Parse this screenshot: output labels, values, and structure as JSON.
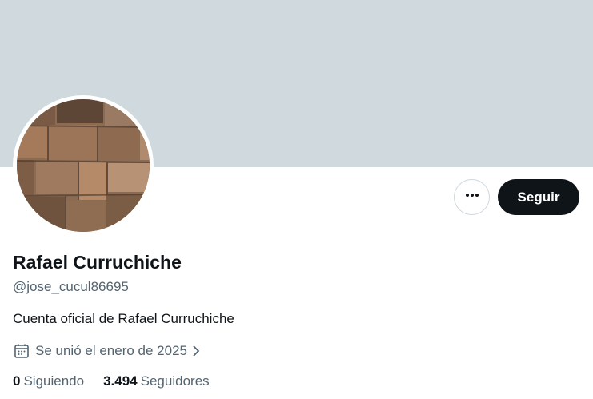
{
  "profile": {
    "name": "Rafael Curruchiche",
    "handle": "@jose_cucul86695",
    "bio": "Cuenta oficial de Rafael Curruchiche",
    "joined": "Se unió el enero de 2025",
    "following_count": "0",
    "following_label": "Siguiendo",
    "followers_count": "3.494",
    "followers_label": "Seguidores"
  },
  "actions": {
    "follow_label": "Seguir",
    "more_icon": "more-icon"
  },
  "colors": {
    "banner": "#cfd9de",
    "primary_text": "#0f1419",
    "secondary_text": "#536471",
    "follow_button": "#0f1419"
  }
}
